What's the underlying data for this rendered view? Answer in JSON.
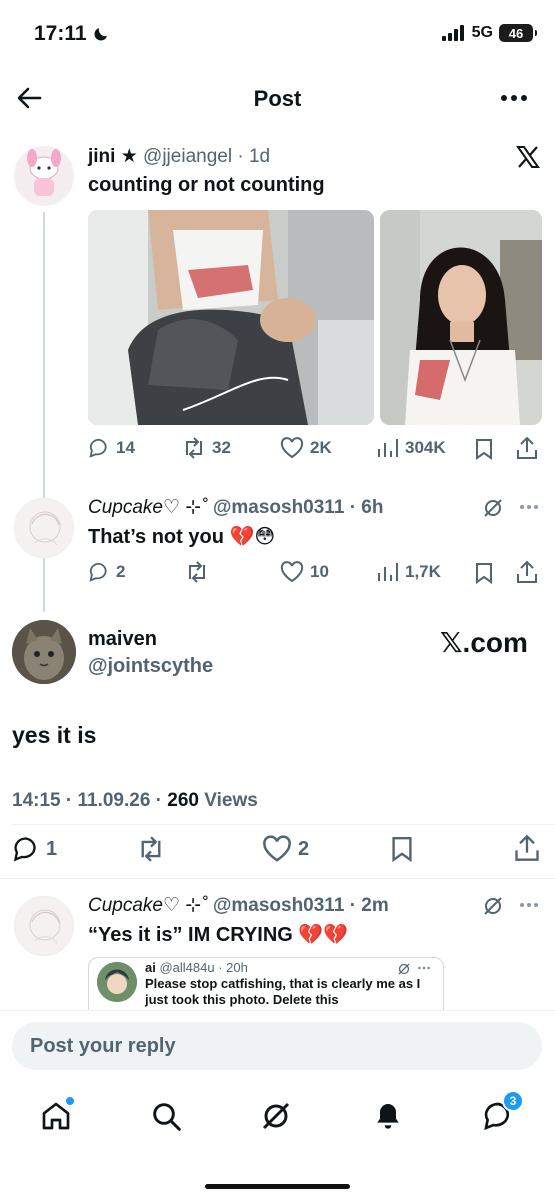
{
  "status_bar": {
    "time": "17:11",
    "network": "5G",
    "battery": "46"
  },
  "header": {
    "title": "Post"
  },
  "post1": {
    "name": "jini ★",
    "handle": "@jjeiangel",
    "age": "· 1d",
    "text": "counting or not counting",
    "stats": {
      "replies": "14",
      "reposts": "32",
      "likes": "2K",
      "views": "304K"
    }
  },
  "reply1": {
    "name": "Cupcake♡ ⊹˚",
    "handle": "@masosh0311",
    "age": "· 6h",
    "text": "That’s not you 💔😳",
    "stats": {
      "replies": "2",
      "likes": "10",
      "views": "1,7K"
    }
  },
  "main_post": {
    "name": "maiven",
    "handle": "@jointscythe",
    "watermark": "𝕏.com",
    "text": "yes it is",
    "timestamp": "14:15 · 11.09.26 · ",
    "views_count": "260",
    "views_label": "Views",
    "stats": {
      "replies": "1",
      "likes": "2"
    }
  },
  "reply2": {
    "name": "Cupcake♡ ⊹˚",
    "handle": "@masosh0311",
    "age": "· 2m",
    "text": "“Yes it is” IM CRYING 💔💔",
    "quote": {
      "name": "ai",
      "handle": "@all484u",
      "age": "· 20h",
      "text": "Please stop catfishing, that is clearly me as I just took this photo. Delete this"
    }
  },
  "compose": {
    "placeholder": "Post your reply"
  },
  "tabbar": {
    "messages_badge": "3"
  }
}
